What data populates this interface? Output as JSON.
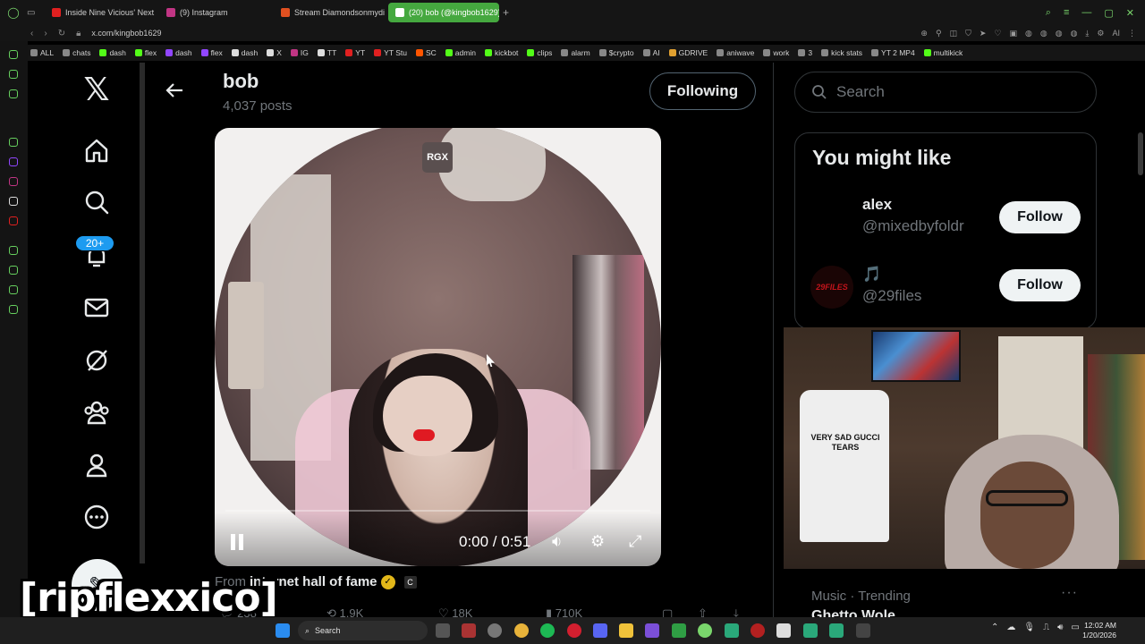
{
  "browser": {
    "tabs": [
      {
        "label": "Inside Nine Vicious' Next I",
        "color": "#e02020"
      },
      {
        "label": "(9) Instagram",
        "color": "#c13584"
      },
      {
        "label": "Stream Diamondsonmydic",
        "color": "#e05020"
      },
      {
        "label": "(20) bob (@kingbob1629)",
        "color": "#ffffff",
        "active": true
      }
    ],
    "url": "x.com/kingbob1629",
    "bookmarks": [
      {
        "label": "ALL",
        "color": "#888"
      },
      {
        "label": "chats",
        "color": "#888"
      },
      {
        "label": "dash",
        "color": "#53fc18"
      },
      {
        "label": "flex",
        "color": "#53fc18"
      },
      {
        "label": "dash",
        "color": "#9146ff"
      },
      {
        "label": "flex",
        "color": "#9146ff"
      },
      {
        "label": "dash",
        "color": "#ddd"
      },
      {
        "label": "X",
        "color": "#ddd"
      },
      {
        "label": "IG",
        "color": "#c13584"
      },
      {
        "label": "TT",
        "color": "#ddd"
      },
      {
        "label": "YT",
        "color": "#e02020"
      },
      {
        "label": "YT Stu",
        "color": "#e02020"
      },
      {
        "label": "SC",
        "color": "#ff5500"
      },
      {
        "label": "admin",
        "color": "#53fc18"
      },
      {
        "label": "kickbot",
        "color": "#53fc18"
      },
      {
        "label": "clips",
        "color": "#53fc18"
      },
      {
        "label": "alarm",
        "color": "#888"
      },
      {
        "label": "$crypto",
        "color": "#888"
      },
      {
        "label": "AI",
        "color": "#888"
      },
      {
        "label": "GDRIVE",
        "color": "#e0a030"
      },
      {
        "label": "aniwave",
        "color": "#888"
      },
      {
        "label": "work",
        "color": "#888"
      },
      {
        "label": "3",
        "color": "#888"
      },
      {
        "label": "kick stats",
        "color": "#888"
      },
      {
        "label": "YT 2 MP4",
        "color": "#888"
      },
      {
        "label": "multikick",
        "color": "#53fc18"
      }
    ]
  },
  "nav": {
    "notif_badge": "20+"
  },
  "header": {
    "name": "bob",
    "posts": "4,037 posts",
    "following_label": "Following"
  },
  "video": {
    "watermark": "RGX",
    "time": "0:00 / 0:51",
    "progress": 0.0
  },
  "post": {
    "from_prefix": "From",
    "source": "internet hall of fame",
    "source_badge": "C",
    "stats": {
      "replies": "238",
      "reposts": "1.9K",
      "likes": "18K",
      "views": "710K"
    }
  },
  "sidebar": {
    "search_placeholder": "Search",
    "might_like_title": "You might like",
    "suggestions": [
      {
        "name": "alex",
        "handle": "@mixedbyfoldr",
        "button": "Follow"
      },
      {
        "name": "🎵",
        "handle": "@29files",
        "button": "Follow",
        "avatar_text": "29FILES"
      }
    ],
    "trend": {
      "category": "Music · Trending",
      "name": "Ghetto Wole",
      "more": "···"
    }
  },
  "webcam": {
    "shirt_text": "VERY SAD GUCCI TEARS"
  },
  "overlay": {
    "text": "[ripflexxico]"
  },
  "taskbar": {
    "search_label": "Search",
    "time": "12:02 AM",
    "date": "1/20/2026"
  }
}
